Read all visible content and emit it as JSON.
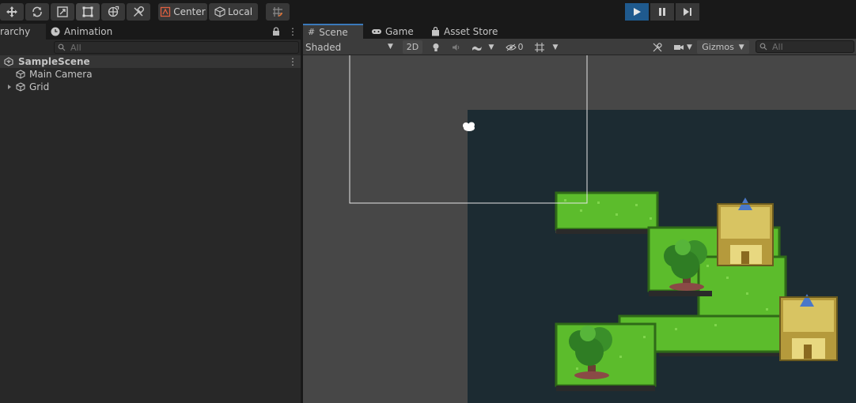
{
  "toolbar": {
    "tools": [
      "move-tool-icon",
      "rotate-tool-icon",
      "scale-tool-icon",
      "rect-tool-icon",
      "transform-tool-icon",
      "custom-tool-icon"
    ],
    "pivot_label": "Center",
    "space_label": "Local"
  },
  "hierarchy": {
    "tab_label": "rarchy",
    "animation_tab_label": "Animation",
    "search_placeholder": "All",
    "scene_name": "SampleScene",
    "items": [
      {
        "label": "Main Camera"
      },
      {
        "label": "Grid"
      }
    ]
  },
  "scene_view": {
    "tabs": [
      {
        "label": "Scene"
      },
      {
        "label": "Game"
      },
      {
        "label": "Asset Store"
      }
    ],
    "shading_mode": "Shaded",
    "mode_2d_label": "2D",
    "hidden_count": "0",
    "gizmos_label": "Gizmos",
    "search_placeholder": "All"
  },
  "colors": {
    "play_active": "#1f5a8e",
    "camera_background": "#1c2b32",
    "grass": "#58b82e"
  }
}
